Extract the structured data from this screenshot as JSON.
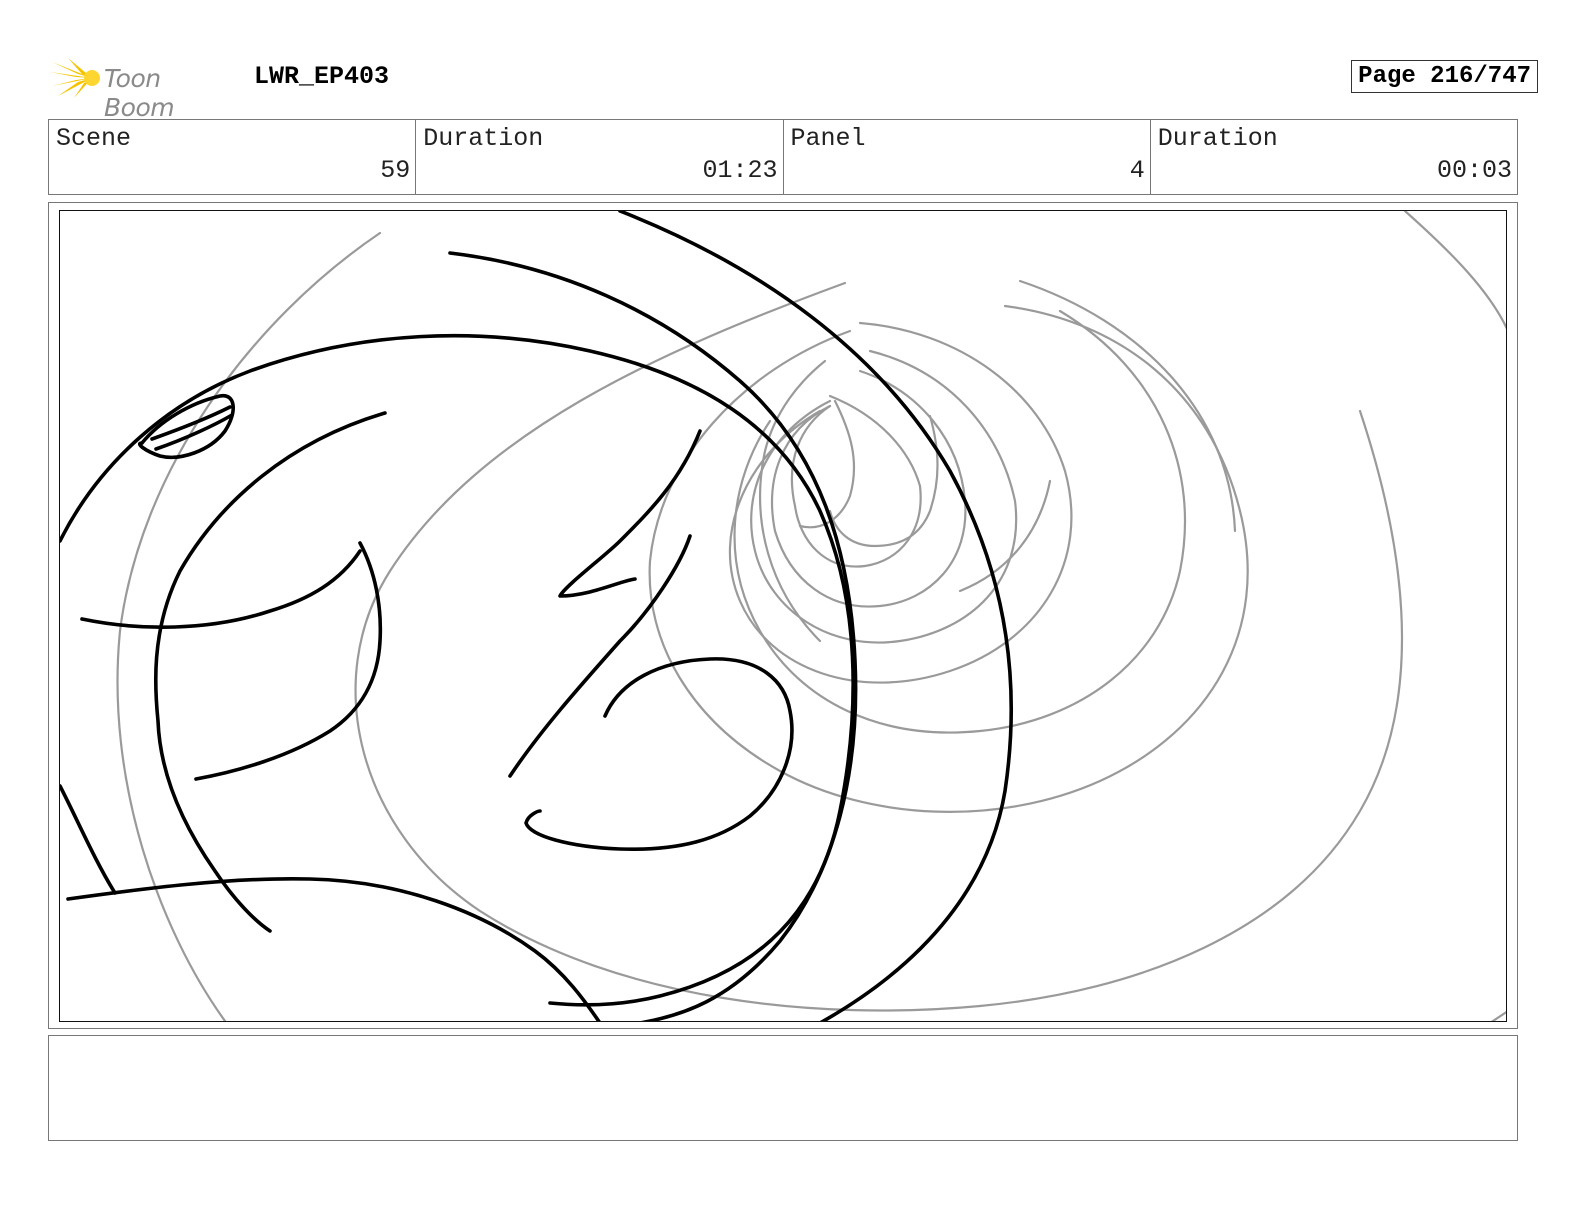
{
  "header": {
    "logo_text": "Toon Boom",
    "project_title": "LWR_EP403",
    "page_label": "Page 216/747"
  },
  "info": {
    "scene_label": "Scene",
    "scene_value": "59",
    "scene_duration_label": "Duration",
    "scene_duration_value": "01:23",
    "panel_label": "Panel",
    "panel_value": "4",
    "panel_duration_label": "Duration",
    "panel_duration_value": "00:03"
  },
  "notes": {
    "text": ""
  },
  "colors": {
    "logo_accent": "#f5c400",
    "sketch_line": "#000000",
    "rough_line": "#9a9a9a"
  }
}
